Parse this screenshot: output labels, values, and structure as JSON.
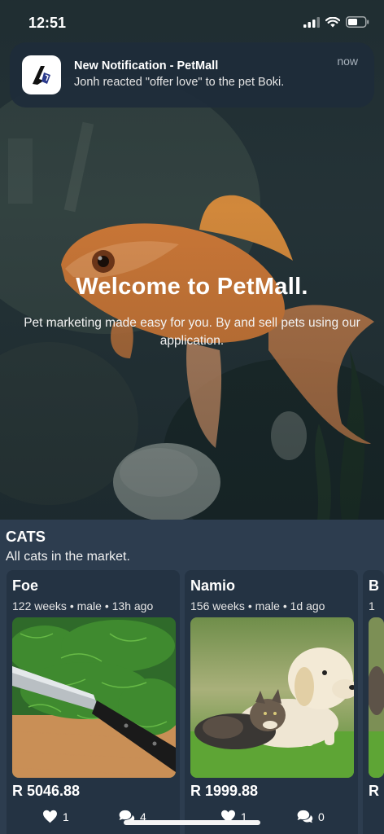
{
  "status_bar": {
    "time": "12:51"
  },
  "notification": {
    "title": "New Notification - PetMall",
    "body": "Jonh reacted \"offer love\" to the pet Boki.",
    "time": "now"
  },
  "hero": {
    "title": "Welcome to PetMall.",
    "subtitle": "Pet marketing made easy for you. By and sell pets using our application."
  },
  "section": {
    "title": "CATS",
    "subtitle": "All cats in the market."
  },
  "cards": [
    {
      "name": "Foe",
      "meta": "122 weeks • male • 13h ago",
      "price": "R 5046.88",
      "likes": "1",
      "comments": "4"
    },
    {
      "name": "Namio",
      "meta": "156 weeks • male • 1d ago",
      "price": "R 1999.88",
      "likes": "1",
      "comments": "0"
    },
    {
      "name": "B",
      "meta": "1",
      "price": "R",
      "likes": "",
      "comments": ""
    }
  ],
  "colors": {
    "background": "#2d3d4f",
    "card": "#243343",
    "accent": "#ffffff"
  }
}
